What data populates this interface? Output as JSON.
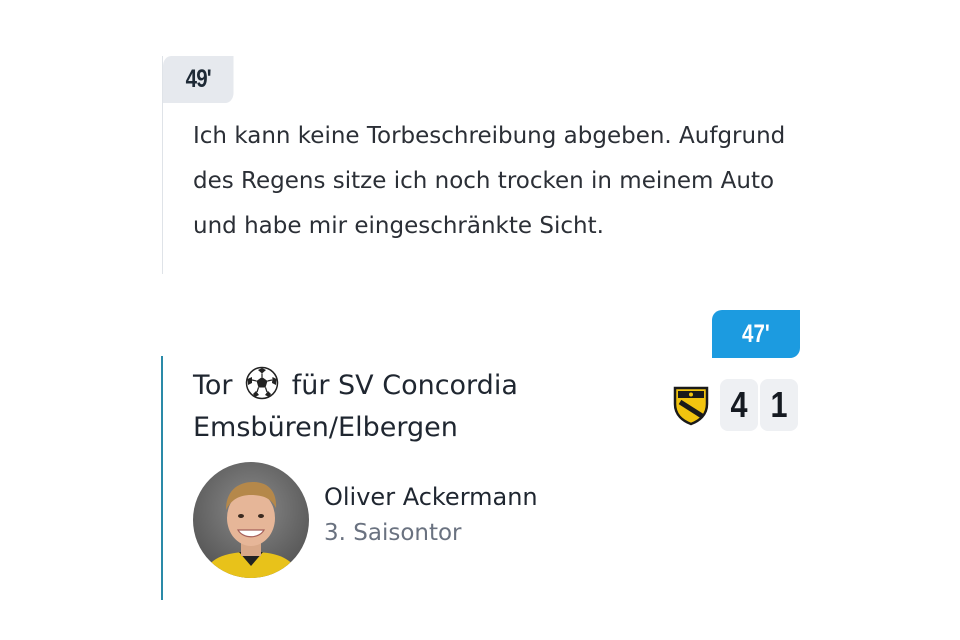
{
  "entries": [
    {
      "minute": "49'",
      "text": "Ich kann keine Torbeschreibung abgeben. Aufgrund des Regens sitze ich noch trocken in meinem Auto und habe mir eingeschränkte Sicht."
    },
    {
      "minute": "47'",
      "title_prefix": "Tor",
      "title_suffix": "für SV Concordia Emsbüren/Elbergen",
      "ball_icon": "soccer-ball-icon",
      "team_crest_icon": "team-crest-icon",
      "score": {
        "home": "4",
        "away": "1"
      },
      "player": {
        "name": "Oliver Ackermann",
        "stat": "3. Saisontor",
        "avatar_icon": "player-avatar"
      }
    }
  ],
  "colors": {
    "minute_badge_grey": "#e6e9ee",
    "minute_badge_blue": "#1c9be0",
    "goal_border": "#2a8aa8",
    "crest_yellow": "#f2c40f",
    "crest_black": "#1a1a1a"
  }
}
